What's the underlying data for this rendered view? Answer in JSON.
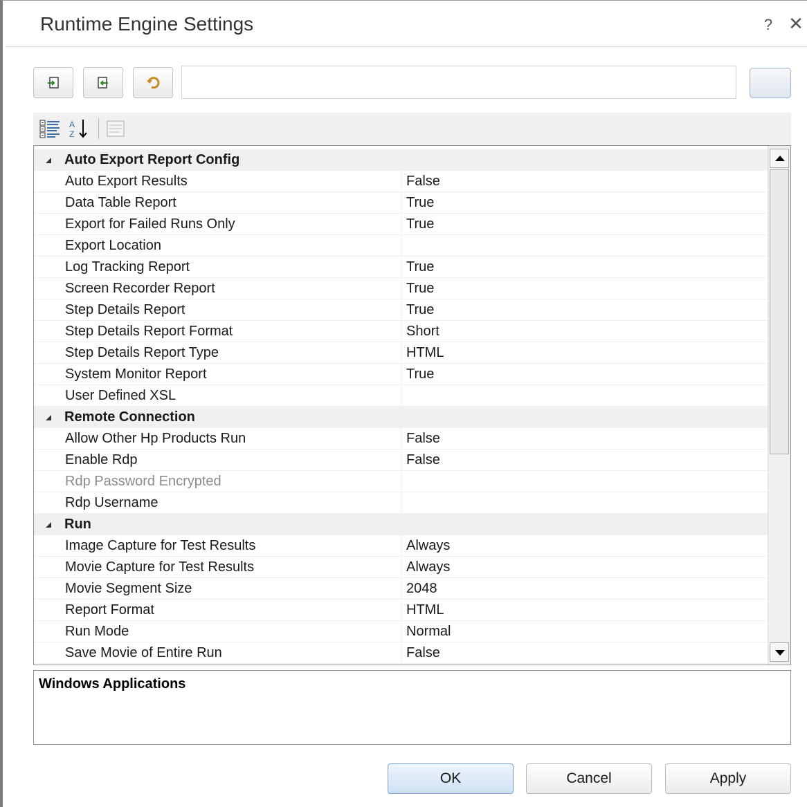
{
  "window": {
    "title": "Runtime Engine Settings",
    "help_label": "?",
    "close_label": "✕"
  },
  "toolbar": {
    "buttons": [
      {
        "icon": "import-icon"
      },
      {
        "icon": "export-icon"
      },
      {
        "icon": "undo-icon"
      }
    ],
    "path_value": ""
  },
  "grid": {
    "categories": [
      {
        "name": "Auto Export Report Config",
        "rows": [
          {
            "name": "Auto Export Results",
            "value": "False"
          },
          {
            "name": "Data Table Report",
            "value": "True"
          },
          {
            "name": "Export for Failed Runs Only",
            "value": "True"
          },
          {
            "name": "Export Location",
            "value": ""
          },
          {
            "name": "Log Tracking Report",
            "value": "True"
          },
          {
            "name": "Screen Recorder Report",
            "value": "True"
          },
          {
            "name": "Step Details Report",
            "value": "True"
          },
          {
            "name": "Step Details Report Format",
            "value": "Short"
          },
          {
            "name": "Step Details Report Type",
            "value": "HTML"
          },
          {
            "name": "System Monitor Report",
            "value": "True"
          },
          {
            "name": "User Defined XSL",
            "value": ""
          }
        ]
      },
      {
        "name": "Remote Connection",
        "rows": [
          {
            "name": "Allow Other Hp Products Run",
            "value": "False"
          },
          {
            "name": "Enable Rdp",
            "value": "False"
          },
          {
            "name": "Rdp Password Encrypted",
            "value": "",
            "disabled": true
          },
          {
            "name": "Rdp Username",
            "value": ""
          }
        ]
      },
      {
        "name": "Run",
        "rows": [
          {
            "name": "Image Capture for Test Results",
            "value": "Always"
          },
          {
            "name": "Movie Capture for Test Results",
            "value": "Always"
          },
          {
            "name": "Movie Segment Size",
            "value": "2048"
          },
          {
            "name": "Report Format",
            "value": "HTML"
          },
          {
            "name": "Run Mode",
            "value": "Normal"
          },
          {
            "name": "Save Movie of Entire Run",
            "value": "False"
          }
        ]
      }
    ]
  },
  "description": {
    "title": "Windows Applications"
  },
  "buttons": {
    "ok": "OK",
    "cancel": "Cancel",
    "apply": "Apply"
  }
}
